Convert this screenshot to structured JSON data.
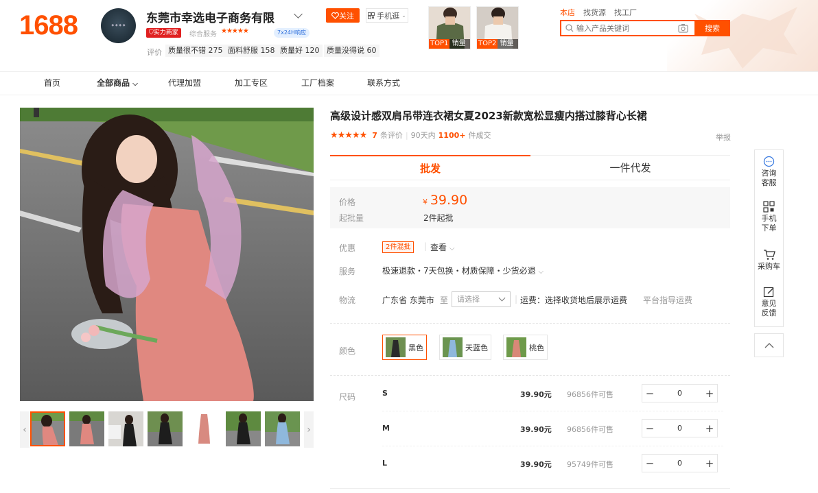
{
  "header": {
    "logo": "1688",
    "shop_name": "东莞市幸选电子商务有限",
    "follow_label": "关注",
    "mobile_label": "手机逛",
    "strength_badge": "实力商家",
    "service_label": "综合服务",
    "service_badge": "7x24H响应",
    "eval_label": "评价",
    "eval_tags": [
      "质量很不错 275",
      "面料舒服 158",
      "质量好 120",
      "质量没得说 60"
    ],
    "top_products": [
      {
        "rank": "TOP1",
        "label": "销量"
      },
      {
        "rank": "TOP2",
        "label": "销量"
      }
    ]
  },
  "search": {
    "tabs": [
      "本店",
      "找货源",
      "找工厂"
    ],
    "placeholder": "输入产品关键词",
    "button": "搜索"
  },
  "nav": {
    "items": [
      "首页",
      "全部商品",
      "代理加盟",
      "加工专区",
      "工厂档案",
      "联系方式"
    ]
  },
  "product": {
    "title": "高级设计感双肩吊带连衣裙女夏2023新款宽松显瘦内搭过膝背心长裙",
    "rating": 5,
    "review_count": "7",
    "review_suffix": "条评价",
    "days_label": "90天内",
    "sold_count": "1100+",
    "sold_suffix": "件成交",
    "report": "举报",
    "tabs": [
      "批发",
      "一件代发"
    ],
    "price_label": "价格",
    "currency": "¥",
    "price": "39.90",
    "moq_label": "起批量",
    "moq_value": "2件起批",
    "promo_label": "优惠",
    "promo_tag": "2件混批",
    "promo_more": "查看",
    "service_label": "服务",
    "service_value": "极速退款・7天包换・材质保障・少货必退",
    "logistics_label": "物流",
    "origin": "广东省 东莞市",
    "to_label": "至",
    "dest_placeholder": "请选择",
    "shipping_text": "运费：选择收货地后展示运费",
    "platform_guide": "平台指导运费",
    "color_label": "颜色",
    "colors": [
      {
        "name": "黑色",
        "hex": "#2a2a2a"
      },
      {
        "name": "天蓝色",
        "hex": "#8fb8dc"
      },
      {
        "name": "桃色",
        "hex": "#d98878"
      }
    ],
    "size_label": "尺码",
    "sizes": [
      {
        "name": "S",
        "price": "39.90元",
        "stock": "96856件可售",
        "qty": "0"
      },
      {
        "name": "M",
        "price": "39.90元",
        "stock": "96856件可售",
        "qty": "0"
      },
      {
        "name": "L",
        "price": "39.90元",
        "stock": "95749件可售",
        "qty": "0"
      }
    ]
  },
  "rail": {
    "items": [
      {
        "label1": "咨询",
        "label2": "客服"
      },
      {
        "label1": "手机",
        "label2": "下单"
      },
      {
        "label1": "采购车",
        "label2": ""
      },
      {
        "label1": "意见",
        "label2": "反馈"
      }
    ]
  },
  "colors": {
    "accent": "#ff5000",
    "badge_red": "#e02020",
    "badge_blue": "#2a6cdb"
  }
}
